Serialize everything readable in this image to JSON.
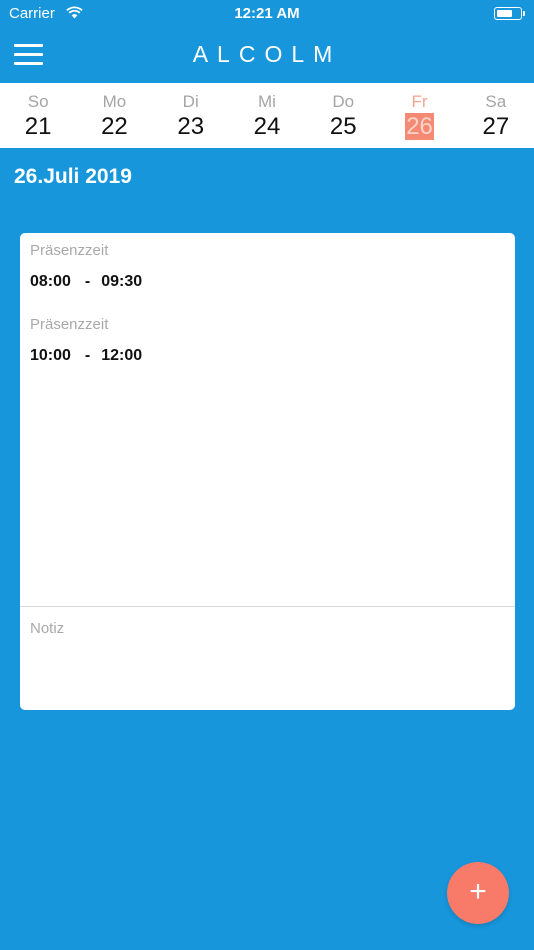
{
  "status_bar": {
    "carrier": "Carrier",
    "time": "12:21 AM"
  },
  "nav": {
    "logo": "ALCOLM",
    "menu_icon": "hamburger-menu-icon"
  },
  "week": {
    "days": [
      {
        "name": "So",
        "num": "21"
      },
      {
        "name": "Mo",
        "num": "22"
      },
      {
        "name": "Di",
        "num": "23"
      },
      {
        "name": "Mi",
        "num": "24"
      },
      {
        "name": "Do",
        "num": "25"
      },
      {
        "name": "Fr",
        "num": "26"
      },
      {
        "name": "Sa",
        "num": "27"
      }
    ],
    "selected_index": 5
  },
  "date_title": "26.Juli 2019",
  "entries": [
    {
      "label": "Präsenzzeit",
      "start": "08:00",
      "dash": "-",
      "end": "09:30"
    },
    {
      "label": "Präsenzzeit",
      "start": "10:00",
      "dash": "-",
      "end": "12:00"
    }
  ],
  "note": {
    "label": "Notiz"
  },
  "fab": {
    "label": "+"
  },
  "colors": {
    "background": "#1796dc",
    "accent": "#f87a68",
    "selected_day": "#f48a73"
  }
}
